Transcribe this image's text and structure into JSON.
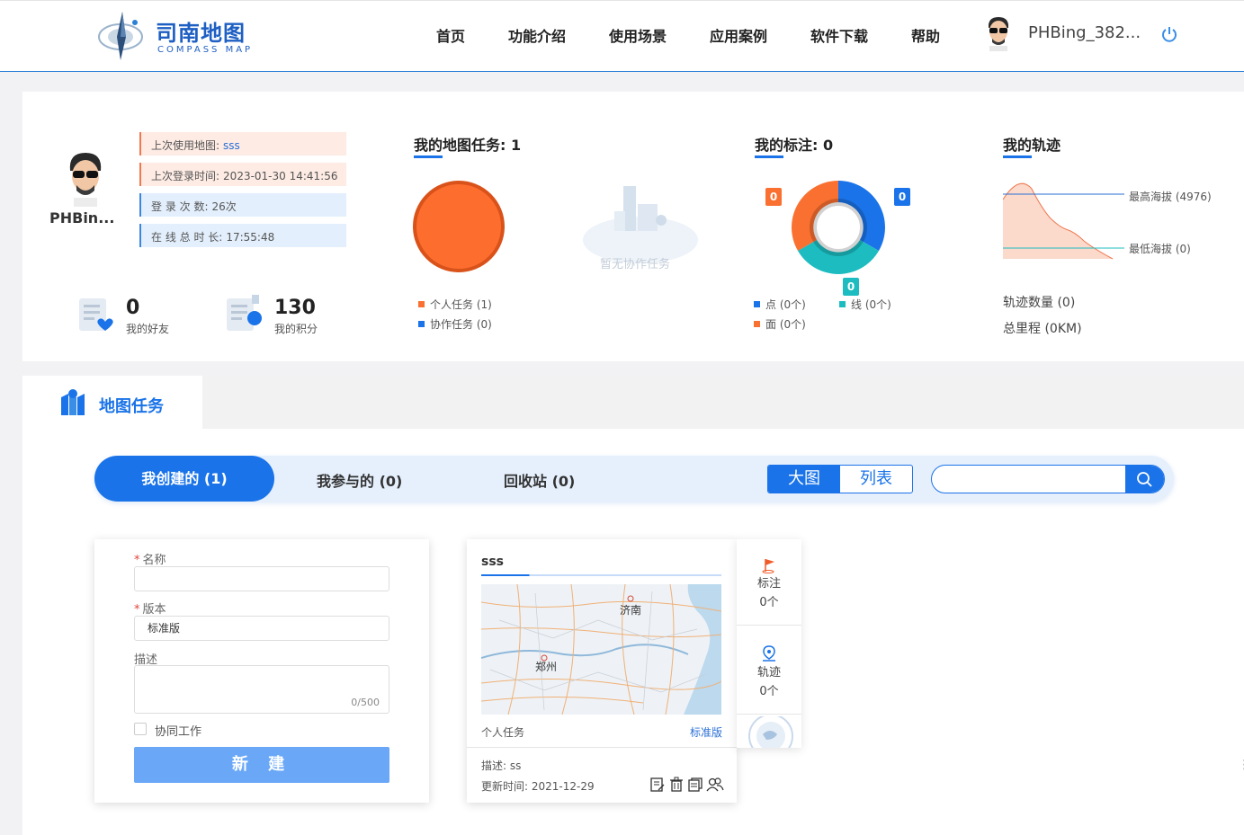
{
  "header": {
    "logo_cn": "司南地图",
    "logo_en": "COMPASS MAP",
    "nav": [
      "首页",
      "功能介绍",
      "使用场景",
      "应用案例",
      "软件下载",
      "帮助"
    ],
    "username": "PHBing_382..."
  },
  "profile": {
    "display_name": "PHBin...",
    "info": [
      {
        "label": "上次使用地图:",
        "value": "sss"
      },
      {
        "label": "上次登录时间:",
        "value": "2023-01-30 14:41:56"
      },
      {
        "label": "登 录 次 数:",
        "value": "26次"
      },
      {
        "label": "在 线 总 时 长:",
        "value": "17:55:48"
      }
    ],
    "friends": {
      "count": "0",
      "label": "我的好友"
    },
    "points": {
      "count": "130",
      "label": "我的积分"
    }
  },
  "map_tasks": {
    "title": "我的地图任务: 1",
    "collab_empty": "暂无协作任务",
    "legend": [
      {
        "label": "个人任务 (1)",
        "color": "#f97030"
      },
      {
        "label": "协作任务 (0)",
        "color": "#1a73e8"
      }
    ]
  },
  "marks": {
    "title": "我的标注: 0",
    "badges": {
      "left": "0",
      "right": "0",
      "bottom": "0"
    },
    "legend": [
      {
        "label": "点 (0个)",
        "color": "#1a73e8"
      },
      {
        "label": "线 (0个)",
        "color": "#1cbcc0"
      },
      {
        "label": "面 (0个)",
        "color": "#f97030"
      }
    ]
  },
  "tracks": {
    "title": "我的轨迹",
    "max_alt": "最高海拔 (4976)",
    "min_alt": "最低海拔 (0)",
    "count": "轨迹数量 (0)",
    "distance": "总里程 (0KM)"
  },
  "tasks_panel": {
    "tab": "地图任务",
    "filters": [
      "我创建的 (1)",
      "我参与的 (0)",
      "回收站 (0)"
    ],
    "view_modes": [
      "大图",
      "列表"
    ],
    "search": {
      "placeholder": "",
      "value": ""
    }
  },
  "form": {
    "name_label": "名称",
    "name_value": "",
    "version_label": "版本",
    "version_value": "标准版",
    "desc_label": "描述",
    "desc_counter": "0/500",
    "collab_label": "协同工作",
    "create_button": "新 建"
  },
  "map_card": {
    "title": "sss",
    "city_1": "济南",
    "city_2": "郑州",
    "type": "个人任务",
    "edition": "标准版",
    "desc": "描述: ss",
    "updated": "更新时间: 2021-12-29",
    "side": [
      {
        "label": "标注",
        "count": "0个"
      },
      {
        "label": "轨迹",
        "count": "0个"
      }
    ]
  },
  "colors": {
    "primary": "#1a73e8",
    "orange": "#f97030",
    "teal": "#1cbcc0"
  }
}
